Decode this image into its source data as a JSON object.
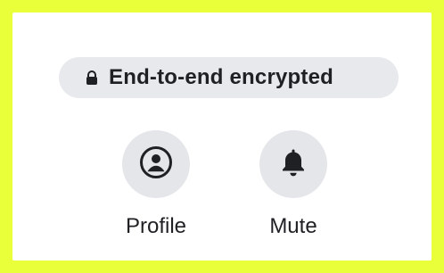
{
  "encryption_badge": {
    "icon": "lock-icon",
    "label": "End-to-end encrypted"
  },
  "actions": [
    {
      "label": "Profile",
      "icon": "user-circle-icon"
    },
    {
      "label": "Mute",
      "icon": "bell-icon"
    }
  ],
  "colors": {
    "outer_frame": "#E9FF3A",
    "panel_bg": "#FFFFFF",
    "badge_bg": "#E8E9EC",
    "button_bg": "#E5E6EA",
    "text": "#1F2024"
  }
}
